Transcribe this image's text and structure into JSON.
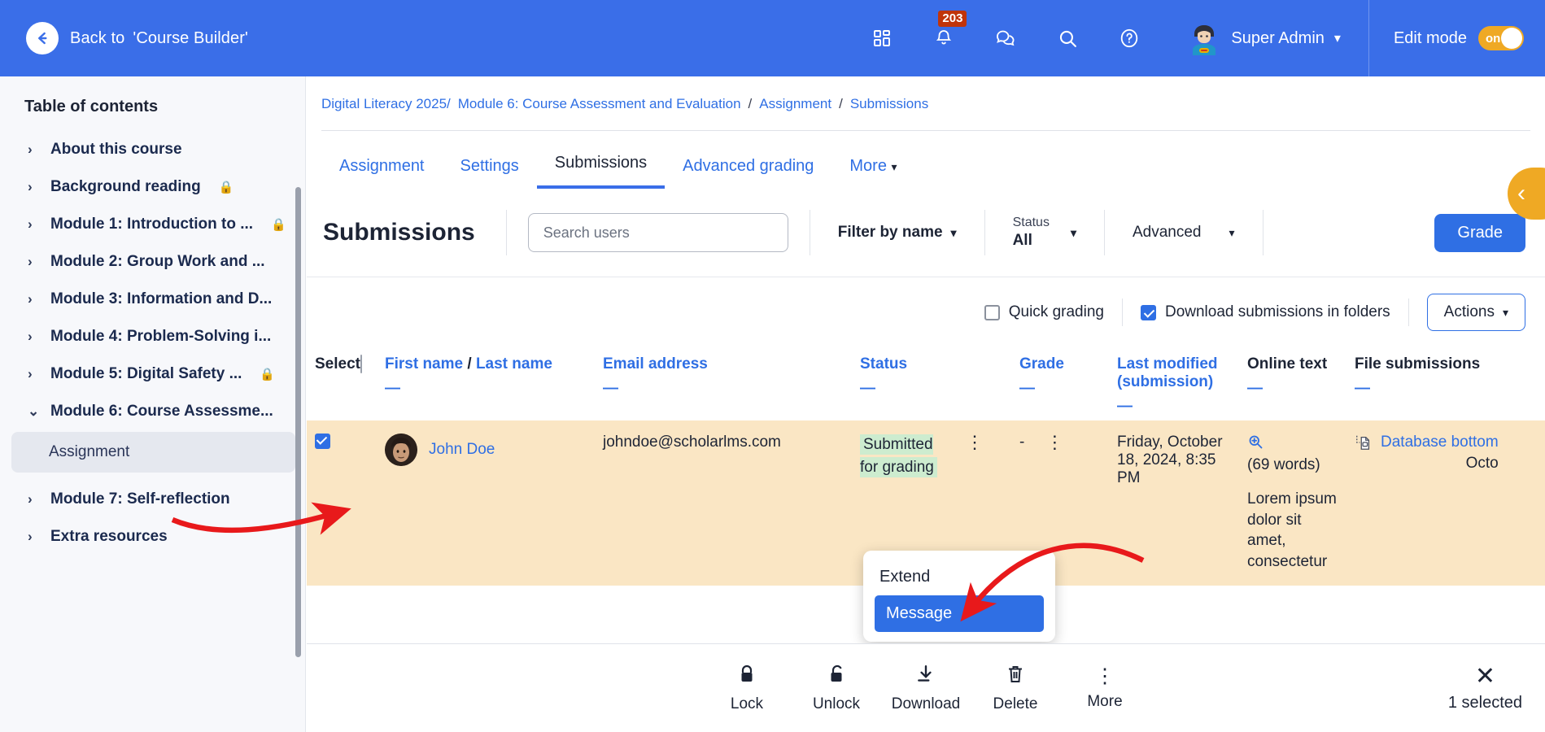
{
  "navbar": {
    "back_label": "Back to",
    "back_target": "'Course Builder'",
    "back_icon": "arrow-left-circle-icon",
    "grid_icon": "dashboard-grid-icon",
    "bell_icon": "notifications-bell-icon",
    "notification_count": "203",
    "messages_icon": "messages-bubbles-icon",
    "search_icon": "search-icon",
    "help_icon": "help-question-icon",
    "user_name": "Super Admin",
    "user_caret": "chevron-down-icon",
    "edit_mode_label": "Edit mode",
    "edit_mode_state": "on",
    "brand_color": "#3a6ee8",
    "toggle_color": "#efa924",
    "badge_color": "#c0340a"
  },
  "sidebar": {
    "title": "Table of contents",
    "items": [
      {
        "label": "About this course",
        "chevron": "›",
        "locked": false
      },
      {
        "label": "Background reading",
        "chevron": "›",
        "locked": true
      },
      {
        "label": "Module 1: Introduction to ...",
        "chevron": "›",
        "locked": true
      },
      {
        "label": "Module 2: Group Work and ...",
        "chevron": "›",
        "locked": false
      },
      {
        "label": "Module 3: Information and D...",
        "chevron": "›",
        "locked": false
      },
      {
        "label": "Module 4: Problem-Solving i...",
        "chevron": "›",
        "locked": false
      },
      {
        "label": "Module 5: Digital Safety ...",
        "chevron": "›",
        "locked": true
      },
      {
        "label": "Module 6: Course Assessme...",
        "chevron": "⌄",
        "locked": false
      }
    ],
    "active_child": "Assignment",
    "items_after": [
      {
        "label": "Module 7: Self-reflection",
        "chevron": "›",
        "locked": false
      },
      {
        "label": "Extra resources",
        "chevron": "›",
        "locked": false
      }
    ]
  },
  "breadcrumb": {
    "course": "Digital Literacy 2025/",
    "module": "Module 6: Course Assessment and Evaluation",
    "activity": "Assignment",
    "page": "Submissions",
    "separator": "/"
  },
  "tabs": [
    {
      "label": "Assignment",
      "active": false
    },
    {
      "label": "Settings",
      "active": false
    },
    {
      "label": "Submissions",
      "active": true
    },
    {
      "label": "Advanced grading",
      "active": false
    },
    {
      "label": "More",
      "active": false,
      "caret": "chevron-down-icon"
    }
  ],
  "toolbar": {
    "page_title": "Submissions",
    "search_placeholder": "Search users",
    "search_value": "",
    "filter_by_name": "Filter by name",
    "status_label": "Status",
    "status_value": "All",
    "advanced_label": "Advanced",
    "grade_button": "Grade"
  },
  "subtoolbar": {
    "quick_grading_label": "Quick grading",
    "quick_grading_checked": false,
    "download_folders_label": "Download submissions in folders",
    "download_folders_checked": true,
    "actions_label": "Actions"
  },
  "table": {
    "headers": [
      {
        "label": "Select",
        "link": false,
        "sort": ""
      },
      {
        "label": "First name",
        "second": "Last name",
        "separator": "/",
        "link": true,
        "sort": "—"
      },
      {
        "label": "Email address",
        "link": true,
        "sort": "—"
      },
      {
        "label": "Status",
        "link": true,
        "sort": "—"
      },
      {
        "label": "Grade",
        "link": true,
        "sort": "—"
      },
      {
        "label": "Last modified (submission)",
        "link": true,
        "sort": "—"
      },
      {
        "label": "Online text",
        "link": false,
        "sort": "—"
      },
      {
        "label": "File submissions",
        "link": false,
        "sort": "—"
      }
    ],
    "rows": [
      {
        "selected": true,
        "name": "John Doe",
        "email": "johndoe@scholarlms.com",
        "status": "Submitted for grading",
        "status_menu_icon": "kebab-menu-icon",
        "grade": "-",
        "grade_menu_icon": "kebab-menu-icon",
        "last_modified": "Friday, October 18, 2024, 8:35 PM",
        "online_text_icon": "zoom-in-icon",
        "online_text_words": "(69 words)",
        "online_text_preview": "Lorem ipsum dolor sit amet, consectetur",
        "file_icon": "file-document-icon",
        "file_name": "Database bottom",
        "file_date": "Octo"
      }
    ]
  },
  "popup": {
    "items": [
      {
        "label": "Extend",
        "selected": false
      },
      {
        "label": "Message",
        "selected": true
      }
    ]
  },
  "bottombar": {
    "items": [
      {
        "label": "Lock",
        "icon": "lock-closed-icon"
      },
      {
        "label": "Unlock",
        "icon": "lock-open-icon"
      },
      {
        "label": "Download",
        "icon": "download-icon"
      },
      {
        "label": "Delete",
        "icon": "trash-icon"
      },
      {
        "label": "More",
        "icon": "kebab-menu-icon"
      }
    ],
    "close_icon": "close-icon",
    "selected_count": "1 selected"
  },
  "drawer": {
    "icon": "chevron-left-icon"
  }
}
